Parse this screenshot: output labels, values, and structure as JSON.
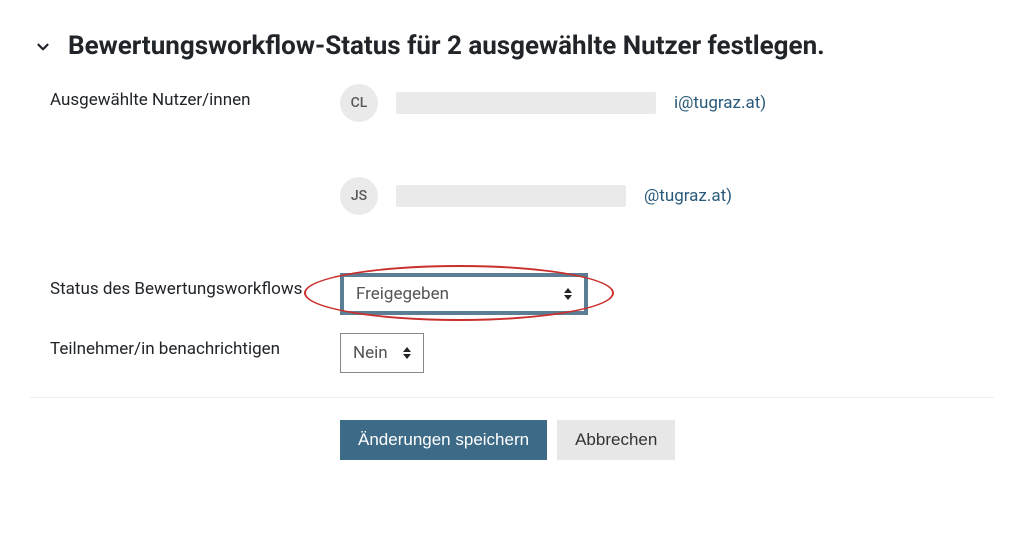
{
  "heading": "Bewertungsworkflow-Status für 2 ausgewählte Nutzer festlegen.",
  "labels": {
    "selected_users": "Ausgewählte Nutzer/innen",
    "workflow_status": "Status des Bewertungsworkflows",
    "notify": "Teilnehmer/in benachrichtigen"
  },
  "users": [
    {
      "initials": "CL",
      "email_suffix": "i@tugraz.at)"
    },
    {
      "initials": "JS",
      "email_suffix": "@tugraz.at)"
    }
  ],
  "workflow_status_value": "Freigegeben",
  "notify_value": "Nein",
  "buttons": {
    "save": "Änderungen speichern",
    "cancel": "Abbrechen"
  }
}
